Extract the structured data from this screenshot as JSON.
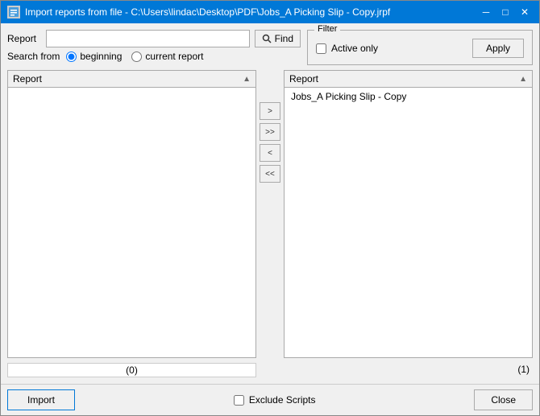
{
  "window": {
    "title": "Import reports from file - C:\\Users\\lindac\\Desktop\\PDF\\Jobs_A Picking Slip - Copy.jrpf",
    "icon": "📋"
  },
  "titlebar": {
    "minimize_label": "─",
    "maximize_label": "□",
    "close_label": "✕"
  },
  "form": {
    "report_label": "Report",
    "report_value": "",
    "find_button_label": "Find",
    "search_from_label": "Search from",
    "radio_beginning_label": "beginning",
    "radio_current_label": "current report",
    "filter_group_label": "Filter",
    "active_only_label": "Active only",
    "apply_button_label": "Apply",
    "left_panel_header": "Report",
    "right_panel_header": "Report",
    "status_left": "(0)",
    "status_right": "(1)",
    "import_button_label": "Import",
    "exclude_scripts_label": "Exclude Scripts",
    "close_button_label": "Close",
    "right_panel_items": [
      {
        "label": "Jobs_A Picking Slip - Copy"
      }
    ],
    "move_right_label": ">",
    "move_all_right_label": ">>",
    "move_left_label": "<",
    "move_all_left_label": "<<"
  }
}
